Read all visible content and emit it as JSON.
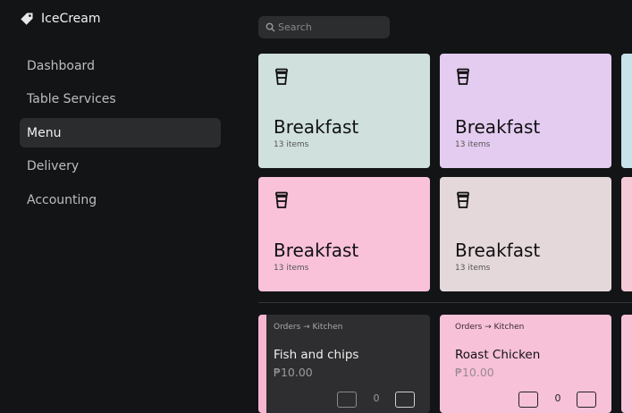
{
  "app": {
    "name": "IceCream"
  },
  "sidebar": {
    "items": [
      {
        "label": "Dashboard",
        "active": false
      },
      {
        "label": "Table Services",
        "active": false
      },
      {
        "label": "Menu",
        "active": true
      },
      {
        "label": "Delivery",
        "active": false
      },
      {
        "label": "Accounting",
        "active": false
      }
    ]
  },
  "search": {
    "placeholder": "Search",
    "value": ""
  },
  "categories": [
    {
      "title": "Breakfast",
      "count": "13 items",
      "color": "#d0e0dc",
      "icon": "coffee-cup-icon"
    },
    {
      "title": "Breakfast",
      "count": "13 items",
      "color": "#e4ccf0",
      "icon": "coffee-cup-icon"
    },
    {
      "title": "Breakfast",
      "count": "13 items",
      "color": "#f9c2d9",
      "icon": "coffee-cup-icon"
    },
    {
      "title": "Breakfast",
      "count": "13 items",
      "color": "#e4d8db",
      "icon": "coffee-cup-icon"
    }
  ],
  "items": [
    {
      "route": "Orders → Kitchen",
      "name": "Fish and chips",
      "price": "₱10.00",
      "quantity": "0",
      "accent": "#f6b6d1",
      "background": "#2e2e30"
    },
    {
      "route": "Orders → Kitchen",
      "name": "Roast Chicken",
      "price": "₱10.00",
      "quantity": "0",
      "accent": "#f6b6d1",
      "background": "#f7c1d8"
    }
  ]
}
